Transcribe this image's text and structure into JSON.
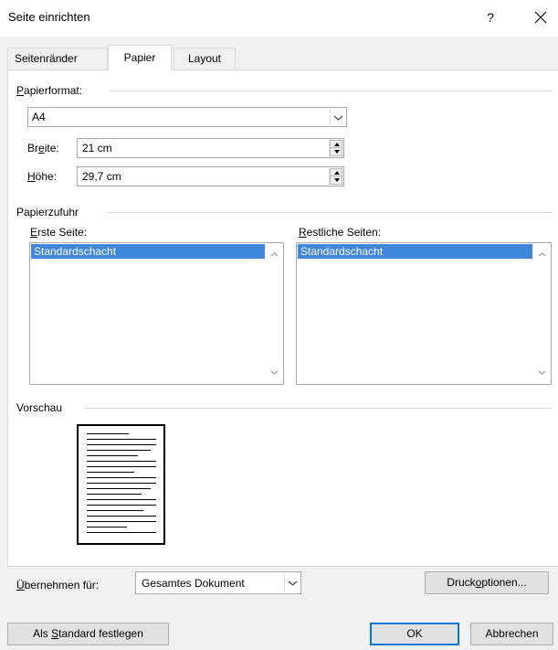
{
  "window": {
    "title": "Seite einrichten",
    "help_label": "?"
  },
  "tabs": [
    {
      "label": "Seitenränder",
      "active": false
    },
    {
      "label": "Papier",
      "active": true
    },
    {
      "label": "Layout",
      "active": false
    }
  ],
  "paper_format": {
    "group_pre": "",
    "group_acc": "P",
    "group_post": "apierformat:",
    "selected": "A4",
    "width_pre": "Br",
    "width_acc": "e",
    "width_post": "ite:",
    "width_value": "21 cm",
    "height_pre": "",
    "height_acc": "H",
    "height_post": "öhe:",
    "height_value": "29,7 cm"
  },
  "paper_source": {
    "group_label": "Papierzufuhr",
    "first_page_pre": "",
    "first_page_acc": "E",
    "first_page_post": "rste Seite:",
    "first_page_selected": "Standardschacht",
    "other_pages_pre": "",
    "other_pages_acc": "R",
    "other_pages_post": "estliche Seiten:",
    "other_pages_selected": "Standardschacht"
  },
  "preview": {
    "group_label": "Vorschau"
  },
  "apply_to": {
    "label_pre": "",
    "label_acc": "Ü",
    "label_post": "bernehmen für:",
    "selected": "Gesamtes Dokument"
  },
  "buttons": {
    "print_options_pre": "Druck",
    "print_options_acc": "o",
    "print_options_post": "ptionen...",
    "set_default_pre": "Als ",
    "set_default_acc": "S",
    "set_default_post": "tandard festlegen",
    "ok": "OK",
    "cancel": "Abbrechen"
  }
}
